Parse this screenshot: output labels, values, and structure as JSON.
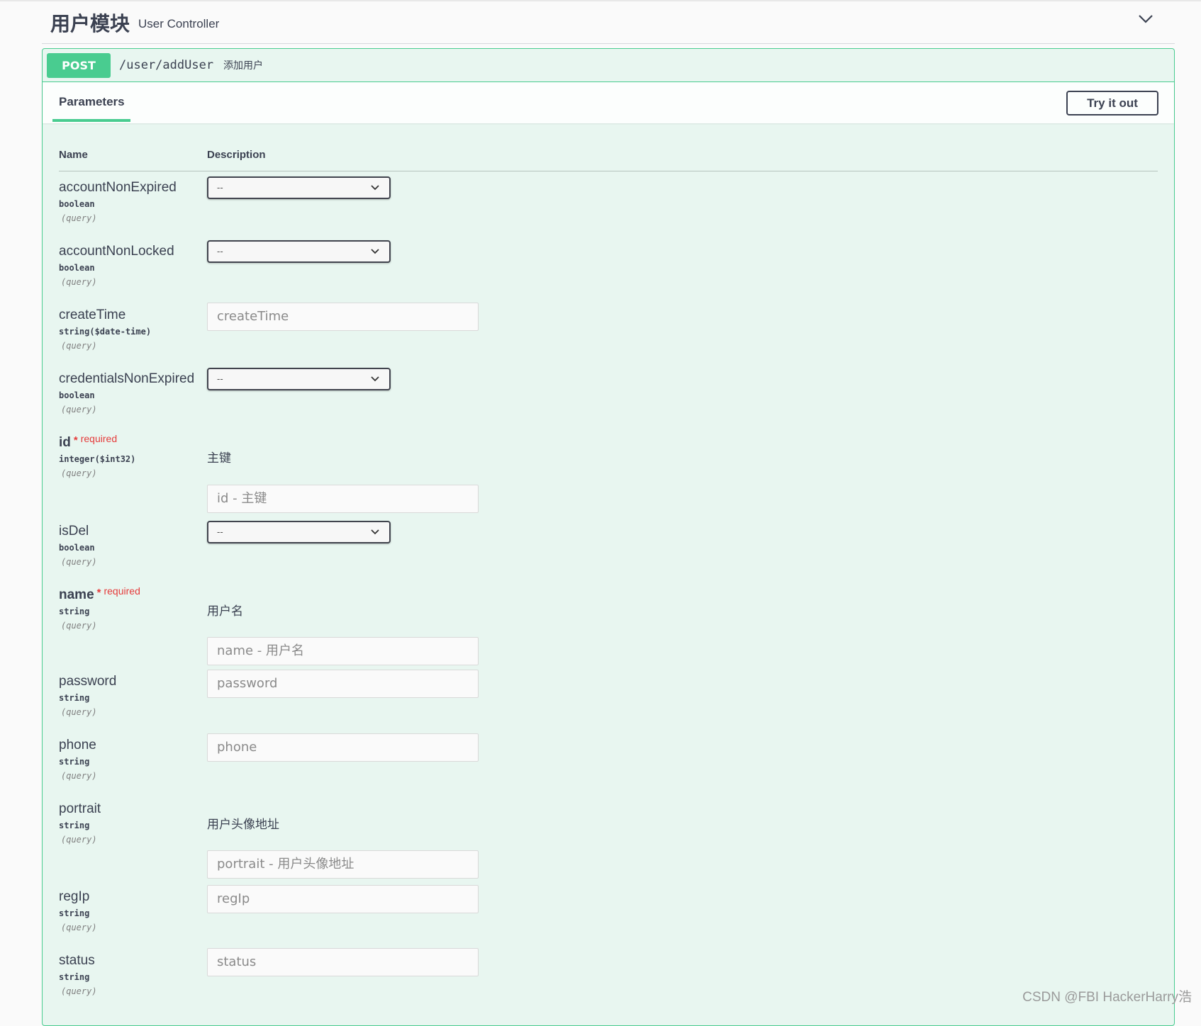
{
  "tag": {
    "title": "用户模块",
    "description": "User Controller"
  },
  "operation": {
    "method": "POST",
    "path": "/user/addUser",
    "summary": "添加用户"
  },
  "section": {
    "tab_label": "Parameters",
    "try_button_label": "Try it out"
  },
  "columns": {
    "name": "Name",
    "description": "Description"
  },
  "params": [
    {
      "name": "accountNonExpired",
      "type": "boolean",
      "in": "(query)",
      "control": "select",
      "value": "--"
    },
    {
      "name": "accountNonLocked",
      "type": "boolean",
      "in": "(query)",
      "control": "select",
      "value": "--"
    },
    {
      "name": "createTime",
      "type": "string($date-time)",
      "in": "(query)",
      "control": "input",
      "placeholder": "createTime"
    },
    {
      "name": "credentialsNonExpired",
      "type": "boolean",
      "in": "(query)",
      "control": "select",
      "value": "--"
    },
    {
      "name": "id",
      "required": true,
      "required_label": "required",
      "type": "integer($int32)",
      "in": "(query)",
      "description": "主键",
      "control": "input",
      "placeholder": "id - 主键"
    },
    {
      "name": "isDel",
      "type": "boolean",
      "in": "(query)",
      "control": "select",
      "value": "--"
    },
    {
      "name": "name",
      "required": true,
      "required_label": "required",
      "type": "string",
      "in": "(query)",
      "description": "用户名",
      "control": "input",
      "placeholder": "name - 用户名"
    },
    {
      "name": "password",
      "type": "string",
      "in": "(query)",
      "control": "input",
      "placeholder": "password"
    },
    {
      "name": "phone",
      "type": "string",
      "in": "(query)",
      "control": "input",
      "placeholder": "phone"
    },
    {
      "name": "portrait",
      "type": "string",
      "in": "(query)",
      "description": "用户头像地址",
      "control": "input",
      "placeholder": "portrait - 用户头像地址"
    },
    {
      "name": "regIp",
      "type": "string",
      "in": "(query)",
      "control": "input",
      "placeholder": "regIp"
    },
    {
      "name": "status",
      "type": "string",
      "in": "(query)",
      "control": "input",
      "placeholder": "status"
    }
  ],
  "watermark": "CSDN @FBI HackerHarry浩",
  "colors": {
    "post": "#49cc90",
    "post_bg": "#e8f6f0",
    "required": "#e53c3c",
    "text": "#3b4151"
  }
}
